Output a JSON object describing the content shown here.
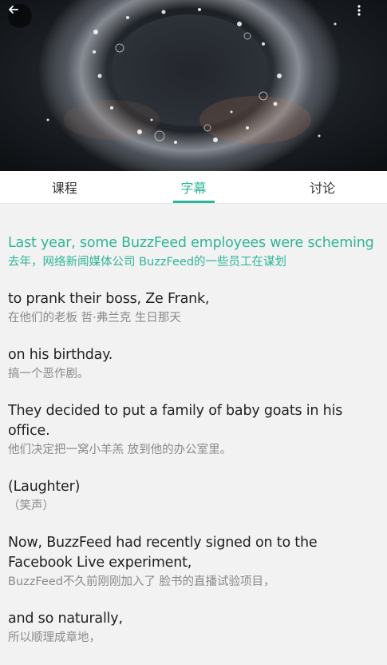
{
  "video": {
    "back_icon": "arrow-left-icon",
    "more_icon": "more-vertical-icon"
  },
  "tabs": [
    {
      "label": "课程",
      "active": false
    },
    {
      "label": "字幕",
      "active": true
    },
    {
      "label": "讨论",
      "active": false
    }
  ],
  "colors": {
    "accent": "#2fb59a",
    "text": "#222222",
    "secondary_text": "#8a8a8a",
    "background": "#f2f2f2"
  },
  "subtitles": [
    {
      "en": "Last year, some BuzzFeed employees were scheming",
      "zh": "去年，网络新闻媒体公司 BuzzFeed的一些员工在谋划",
      "current": true
    },
    {
      "en": "to prank their boss, Ze Frank,",
      "zh": "在他们的老板 哲·弗兰克 生日那天",
      "current": false
    },
    {
      "en": "on his birthday.",
      "zh": "搞一个恶作剧。",
      "current": false
    },
    {
      "en": "They decided to put a family of baby goats in his office.",
      "zh": "他们决定把一窝小羊羔 放到他的办公室里。",
      "current": false
    },
    {
      "en": "(Laughter)",
      "zh": "（笑声）",
      "current": false
    },
    {
      "en": "Now, BuzzFeed had recently signed on to the Facebook Live experiment,",
      "zh": "BuzzFeed不久前刚刚加入了 脸书的直播试验项目，",
      "current": false
    },
    {
      "en": "and so naturally,",
      "zh": "所以顺理成章地，",
      "current": false
    }
  ]
}
